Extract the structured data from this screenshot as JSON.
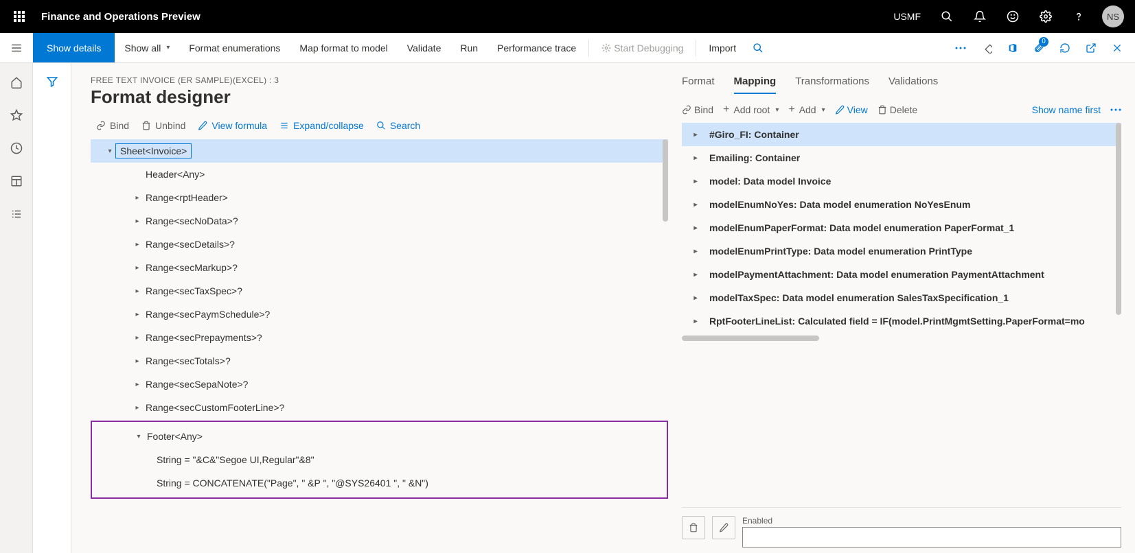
{
  "header": {
    "app_title": "Finance and Operations Preview",
    "company": "USMF",
    "avatar_initials": "NS"
  },
  "cmd": {
    "show_details": "Show details",
    "show_all": "Show all",
    "format_enum": "Format enumerations",
    "map_format": "Map format to model",
    "validate": "Validate",
    "run": "Run",
    "perf_trace": "Performance trace",
    "start_debug": "Start Debugging",
    "import": "Import",
    "attach_badge": "0"
  },
  "breadcrumb": "FREE TEXT INVOICE (ER SAMPLE)(EXCEL) : 3",
  "page_title": "Format designer",
  "toolbar": {
    "bind": "Bind",
    "unbind": "Unbind",
    "view_formula": "View formula",
    "expand": "Expand/collapse",
    "search": "Search"
  },
  "tree": {
    "root": "Sheet<Invoice>",
    "nodes": [
      "Header<Any>",
      "Range<rptHeader>",
      "Range<secNoData>?",
      "Range<secDetails>?",
      "Range<secMarkup>?",
      "Range<secTaxSpec>?",
      "Range<secPaymSchedule>?",
      "Range<secPrepayments>?",
      "Range<secTotals>?",
      "Range<secSepaNote>?",
      "Range<secCustomFooterLine>?"
    ],
    "footer_parent": "Footer<Any>",
    "footer_children": [
      "String = \"&C&\"Segoe UI,Regular\"&8\"",
      "String = CONCATENATE(\"Page\", \" &P \", \"@SYS26401 \", \" &N\")"
    ]
  },
  "tabs": {
    "format": "Format",
    "mapping": "Mapping",
    "transformations": "Transformations",
    "validations": "Validations"
  },
  "map_toolbar": {
    "bind": "Bind",
    "add_root": "Add root",
    "add": "Add",
    "view": "View",
    "delete": "Delete",
    "show_name": "Show name first"
  },
  "map_tree": [
    "#Giro_FI: Container",
    "Emailing: Container",
    "model: Data model Invoice",
    "modelEnumNoYes: Data model enumeration NoYesEnum",
    "modelEnumPaperFormat: Data model enumeration PaperFormat_1",
    "modelEnumPrintType: Data model enumeration PrintType",
    "modelPaymentAttachment: Data model enumeration PaymentAttachment",
    "modelTaxSpec: Data model enumeration SalesTaxSpecification_1",
    "RptFooterLineList: Calculated field = IF(model.PrintMgmtSetting.PaperFormat=mo"
  ],
  "bottom": {
    "enabled_label": "Enabled"
  }
}
